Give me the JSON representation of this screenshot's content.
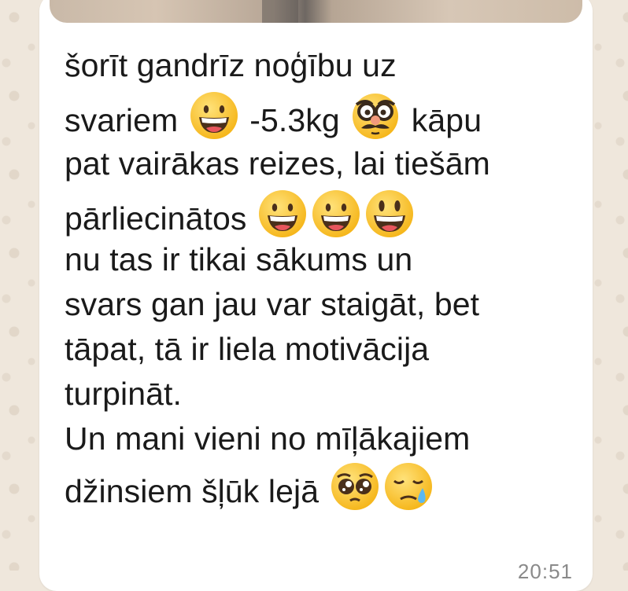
{
  "message": {
    "lines": [
      {
        "text": "šorīt gandrīz noģību uz"
      },
      {
        "before": "svariem",
        "after_emoji1": "-5.3kg",
        "after_emoji2": "kāpu"
      },
      {
        "text": "pat vairākas reizes, lai tiešām"
      },
      {
        "before": "pārliecinātos"
      },
      {
        "text": "nu tas ir tikai sākums un"
      },
      {
        "text": "svars gan jau var staigāt, bet"
      },
      {
        "text": "tāpat, tā ir liela motivācija"
      },
      {
        "text": "turpināt."
      },
      {
        "text": "Un mani vieni no mīļākajiem"
      },
      {
        "before": "džinsiem šļūk lejā"
      }
    ],
    "emojis": {
      "grinning": "grinning-face-emoji",
      "disguise": "disguised-face-emoji",
      "pleading": "pleading-face-emoji",
      "sad_sweat": "sad-but-relieved-face-emoji"
    }
  },
  "colors": {
    "bubble": "#ffffff",
    "wallpaper": "#efe7dc",
    "text": "#1a1a1a"
  },
  "timestamp": "20:51"
}
